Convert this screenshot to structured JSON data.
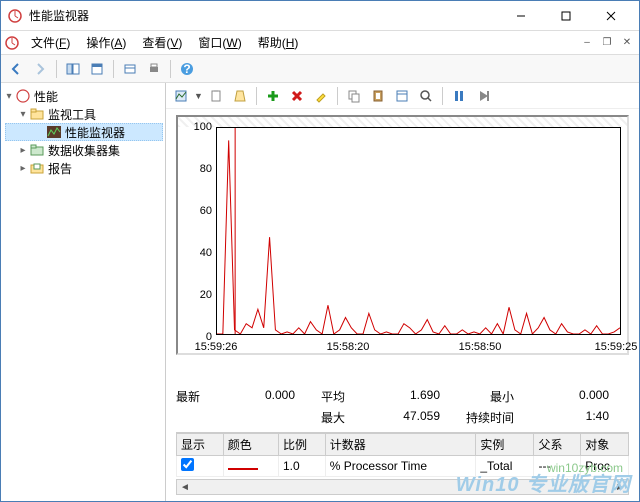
{
  "window": {
    "title": "性能监视器"
  },
  "menu": {
    "app_icon": "perfmon",
    "items": [
      {
        "label": "文件",
        "accel": "F"
      },
      {
        "label": "操作",
        "accel": "A"
      },
      {
        "label": "查看",
        "accel": "V"
      },
      {
        "label": "窗口",
        "accel": "W"
      },
      {
        "label": "帮助",
        "accel": "H"
      }
    ]
  },
  "tree": {
    "root": "性能",
    "nodes": {
      "monitors": "监视工具",
      "perfmon": "性能监视器",
      "dcs": "数据收集器集",
      "reports": "报告"
    }
  },
  "chart_data": {
    "type": "line",
    "ylim": [
      0,
      100
    ],
    "yticks": [
      0,
      20,
      40,
      60,
      80,
      100
    ],
    "xticks": [
      "15:59:26",
      "15:58:20",
      "15:58:50",
      "15:59:25"
    ],
    "series": [
      {
        "name": "% Processor Time",
        "color": "#d00000",
        "values": [
          0,
          0,
          94,
          2,
          0,
          5,
          3,
          12,
          3,
          47,
          2,
          0,
          1,
          0,
          3,
          0,
          6,
          2,
          0,
          14,
          0,
          2,
          8,
          3,
          0,
          0,
          10,
          2,
          0,
          1,
          0,
          0,
          5,
          3,
          0,
          2,
          7,
          1,
          0,
          4,
          0,
          0,
          2,
          0,
          1,
          0,
          3,
          0,
          5,
          0,
          13,
          2,
          0,
          10,
          0,
          3,
          8,
          2,
          0,
          5,
          1,
          0,
          0,
          2,
          0,
          4,
          0,
          0,
          1,
          3
        ]
      }
    ]
  },
  "stats": {
    "latest_label": "最新",
    "latest": "0.000",
    "avg_label": "平均",
    "avg": "1.690",
    "min_label": "最小",
    "min": "0.000",
    "max_label": "最大",
    "max": "47.059",
    "dur_label": "持续时间",
    "dur": "1:40"
  },
  "counters": {
    "headers": {
      "show": "显示",
      "color": "颜色",
      "scale": "比例",
      "counter": "计数器",
      "instance": "实例",
      "parent": "父系",
      "object": "对象"
    },
    "rows": [
      {
        "show": true,
        "color": "#d00000",
        "scale": "1.0",
        "counter": "% Processor Time",
        "instance": "_Total",
        "parent": "---",
        "object": "Proc"
      }
    ]
  },
  "watermark": "Win10 专业版官网",
  "watermark2": "win10zyb.com"
}
